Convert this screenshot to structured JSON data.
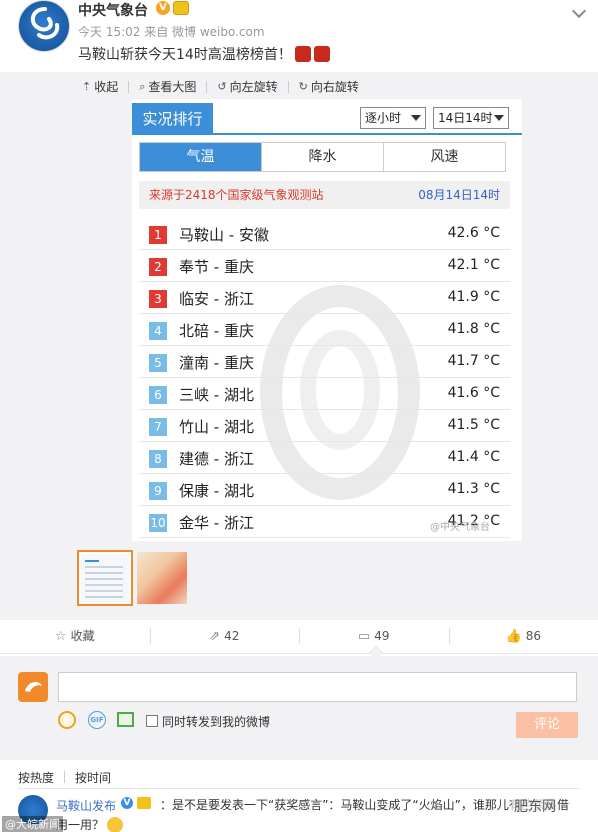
{
  "post": {
    "author": "中央气象台",
    "verified_badge": "V",
    "meta": "今天 15:02 来自 微博 weibo.com",
    "text": "马鞍山斩获今天14时高温榜榜首！"
  },
  "toolbar": {
    "collapse": "收起",
    "view_large": "查看大图",
    "rotate_left": "向左旋转",
    "rotate_right": "向右旋转"
  },
  "ranking_image": {
    "title": "实况排行",
    "interval_select": "逐小时",
    "time_select": "14日14时",
    "tabs": [
      "气温",
      "降水",
      "风速"
    ],
    "active_tab": "气温",
    "source": "来源于2418个国家级气象观测站",
    "timestamp": "08月14日14时",
    "watermark": "@中央气象台",
    "rows": [
      {
        "rank": "1",
        "station": "马鞍山 - 安徽",
        "temp": "42.6 °C"
      },
      {
        "rank": "2",
        "station": "奉节 - 重庆",
        "temp": "42.1 °C"
      },
      {
        "rank": "3",
        "station": "临安 - 浙江",
        "temp": "41.9 °C"
      },
      {
        "rank": "4",
        "station": "北碚 - 重庆",
        "temp": "41.8 °C"
      },
      {
        "rank": "5",
        "station": "潼南 - 重庆",
        "temp": "41.7 °C"
      },
      {
        "rank": "6",
        "station": "三峡 - 湖北",
        "temp": "41.6 °C"
      },
      {
        "rank": "7",
        "station": "竹山 - 湖北",
        "temp": "41.5 °C"
      },
      {
        "rank": "8",
        "station": "建德 - 浙江",
        "temp": "41.4 °C"
      },
      {
        "rank": "9",
        "station": "保康 - 湖北",
        "temp": "41.3 °C"
      },
      {
        "rank": "10",
        "station": "金华 - 浙江",
        "temp": "41.2 °C"
      }
    ]
  },
  "actions": {
    "favorite": "收藏",
    "forward_count": "42",
    "comment_count": "49",
    "like_count": "86"
  },
  "comment_box": {
    "gif_label": "GIF",
    "forward_label": "同时转发到我的微博",
    "submit_label": "评论"
  },
  "sort": {
    "by_heat": "按热度",
    "by_time": "按时间"
  },
  "comment": {
    "author": "马鞍山发布",
    "verified_badge": "V",
    "text": "：是不是要发表一下“获奖感言”：马鞍山变成了“火焰山”，谁那儿有芭蕉扇借",
    "text2": "用一用？"
  },
  "watermarks": {
    "bottom_left": "@大皖新闻",
    "bottom_right": "肥东网"
  },
  "colors": {
    "accent_blue": "#3d8ed8",
    "rank_red": "#e03a36",
    "rank_blue": "#78bde6",
    "submit_disabled": "#fbbfa3"
  }
}
